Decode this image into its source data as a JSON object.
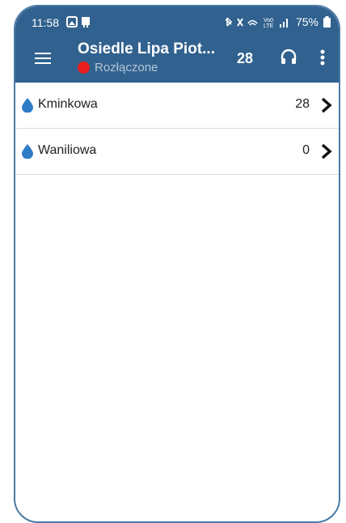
{
  "status_bar": {
    "time": "11:58",
    "battery": "75%",
    "icons": [
      "gallery-icon",
      "screen-icon",
      "bluetooth-icon",
      "mute-icon",
      "wifi-icon",
      "volte-icon",
      "signal-icon",
      "battery-icon"
    ]
  },
  "app_bar": {
    "title": "Osiedle Lipa Piot...",
    "status_text": "Rozłączone",
    "status_color": "#e81e1e",
    "count": "28",
    "icons": [
      "menu-icon",
      "headset-icon",
      "more-vert-icon"
    ]
  },
  "list": {
    "items": [
      {
        "label": "Kminkowa",
        "count": "28",
        "icon": "water-drop-icon"
      },
      {
        "label": "Waniliowa",
        "count": "0",
        "icon": "water-drop-icon"
      }
    ]
  },
  "colors": {
    "header_bg": "#31628f",
    "drop": "#2f7dc6",
    "divider": "#dcdcdc"
  }
}
